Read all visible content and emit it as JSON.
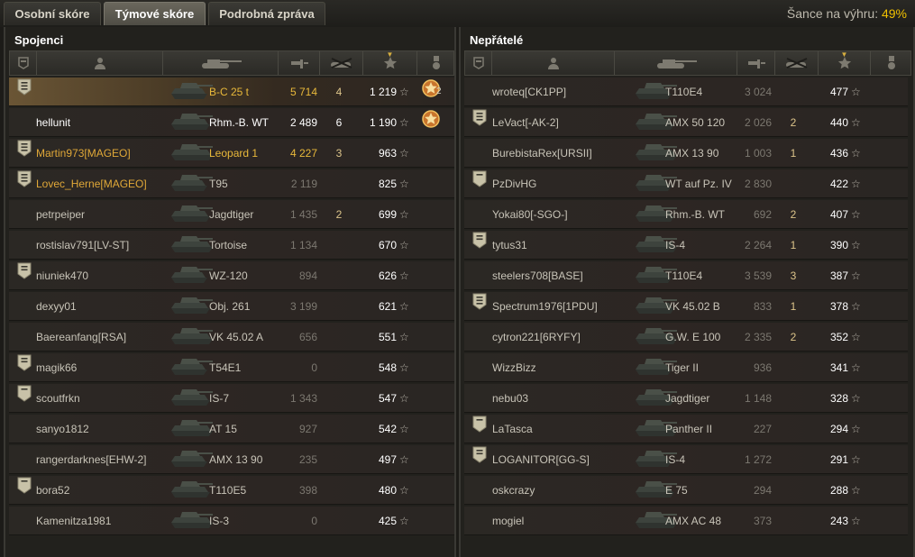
{
  "tabs": [
    {
      "label": "Osobní skóre",
      "active": false
    },
    {
      "label": "Týmové skóre",
      "active": true
    },
    {
      "label": "Podrobná zpráva",
      "active": false
    }
  ],
  "win_chance": {
    "label": "Šance na výhru:",
    "value": "49%"
  },
  "allies": {
    "title": "Spojenci",
    "rows": [
      {
        "badge": "3",
        "player": "",
        "vehicle": "B-C 25 t",
        "damage": "5 714",
        "kills": "4",
        "score": "1 219",
        "style": "gold",
        "highlight": true,
        "medal": true,
        "medal_count": "2"
      },
      {
        "badge": "",
        "player": "hellunit",
        "vehicle": "Rhm.-B. WT",
        "damage": "2 489",
        "kills": "6",
        "score": "1 190",
        "style": "white",
        "highlight": false,
        "medal": true,
        "medal_count": ""
      },
      {
        "badge": "3",
        "player": "Martin973[MAGEO]",
        "vehicle": "Leopard 1",
        "damage": "4 227",
        "kills": "3",
        "score": "963",
        "style": "gold",
        "highlight": false,
        "medal": false
      },
      {
        "badge": "3",
        "player": "Lovec_Herne[MAGEO]",
        "vehicle": "T95",
        "damage": "2 119",
        "kills": "",
        "score": "825",
        "style": "goldname",
        "highlight": false,
        "medal": false
      },
      {
        "badge": "",
        "player": "petrpeiper",
        "vehicle": "Jagdtiger",
        "damage": "1 435",
        "kills": "2",
        "score": "699",
        "style": "normal",
        "highlight": false,
        "medal": false
      },
      {
        "badge": "",
        "player": "rostislav791[LV-ST]",
        "vehicle": "Tortoise",
        "damage": "1 134",
        "kills": "",
        "score": "670",
        "style": "normal",
        "highlight": false,
        "medal": false
      },
      {
        "badge": "2",
        "player": "niuniek470",
        "vehicle": "WZ-120",
        "damage": "894",
        "kills": "",
        "score": "626",
        "style": "normal",
        "highlight": false,
        "medal": false
      },
      {
        "badge": "",
        "player": "dexyy01",
        "vehicle": "Obj. 261",
        "damage": "3 199",
        "kills": "",
        "score": "621",
        "style": "normal",
        "highlight": false,
        "medal": false
      },
      {
        "badge": "",
        "player": "Baereanfang[RSA]",
        "vehicle": "VK 45.02 A",
        "damage": "656",
        "kills": "",
        "score": "551",
        "style": "normal",
        "highlight": false,
        "medal": false
      },
      {
        "badge": "2",
        "player": "magik66",
        "vehicle": "T54E1",
        "damage": "0",
        "kills": "",
        "score": "548",
        "style": "normal",
        "highlight": false,
        "medal": false
      },
      {
        "badge": "1",
        "player": "scoutfrkn",
        "vehicle": "IS-7",
        "damage": "1 343",
        "kills": "",
        "score": "547",
        "style": "normal",
        "highlight": false,
        "medal": false
      },
      {
        "badge": "",
        "player": "sanyo1812",
        "vehicle": "AT 15",
        "damage": "927",
        "kills": "",
        "score": "542",
        "style": "normal",
        "highlight": false,
        "medal": false
      },
      {
        "badge": "",
        "player": "rangerdarknes[EHW-2]",
        "vehicle": "AMX 13 90",
        "damage": "235",
        "kills": "",
        "score": "497",
        "style": "normal",
        "highlight": false,
        "medal": false
      },
      {
        "badge": "1",
        "player": "bora52",
        "vehicle": "T110E5",
        "damage": "398",
        "kills": "",
        "score": "480",
        "style": "normal",
        "highlight": false,
        "medal": false
      },
      {
        "badge": "",
        "player": "Kamenitza1981",
        "vehicle": "IS-3",
        "damage": "0",
        "kills": "",
        "score": "425",
        "style": "normal",
        "highlight": false,
        "medal": false
      }
    ]
  },
  "enemies": {
    "title": "Nepřátelé",
    "rows": [
      {
        "badge": "",
        "player": "wroteq[CK1PP]",
        "vehicle": "T110E4",
        "damage": "3 024",
        "kills": "",
        "score": "477"
      },
      {
        "badge": "3",
        "player": "LeVact[-AK-2]",
        "vehicle": "AMX 50 120",
        "damage": "2 026",
        "kills": "2",
        "score": "440"
      },
      {
        "badge": "",
        "player": "BurebistaRex[URSII]",
        "vehicle": "AMX 13 90",
        "damage": "1 003",
        "kills": "1",
        "score": "436"
      },
      {
        "badge": "1",
        "player": "PzDivHG",
        "vehicle": "WT auf Pz. IV",
        "damage": "2 830",
        "kills": "",
        "score": "422"
      },
      {
        "badge": "",
        "player": "Yokai80[-SGO-]",
        "vehicle": "Rhm.-B. WT",
        "damage": "692",
        "kills": "2",
        "score": "407"
      },
      {
        "badge": "2",
        "player": "tytus31",
        "vehicle": "IS-4",
        "damage": "2 264",
        "kills": "1",
        "score": "390"
      },
      {
        "badge": "",
        "player": "steelers708[BASE]",
        "vehicle": "T110E4",
        "damage": "3 539",
        "kills": "3",
        "score": "387"
      },
      {
        "badge": "3",
        "player": "Spectrum1976[1PDU]",
        "vehicle": "VK 45.02 B",
        "damage": "833",
        "kills": "1",
        "score": "378"
      },
      {
        "badge": "",
        "player": "cytron221[6RYFY]",
        "vehicle": "G.W. E 100",
        "damage": "2 335",
        "kills": "2",
        "score": "352"
      },
      {
        "badge": "",
        "player": "WizzBizz",
        "vehicle": "Tiger II",
        "damage": "936",
        "kills": "",
        "score": "341"
      },
      {
        "badge": "",
        "player": "nebu03",
        "vehicle": "Jagdtiger",
        "damage": "1 148",
        "kills": "",
        "score": "328"
      },
      {
        "badge": "1",
        "player": "LaTasca",
        "vehicle": "Panther II",
        "damage": "227",
        "kills": "",
        "score": "294"
      },
      {
        "badge": "2",
        "player": "LOGANITOR[GG-S]",
        "vehicle": "IS-4",
        "damage": "1 272",
        "kills": "",
        "score": "291"
      },
      {
        "badge": "",
        "player": "oskcrazy",
        "vehicle": "E 75",
        "damage": "294",
        "kills": "",
        "score": "288"
      },
      {
        "badge": "",
        "player": "mogiel",
        "vehicle": "AMX AC 48",
        "damage": "373",
        "kills": "",
        "score": "243"
      }
    ]
  },
  "icons": {
    "col_badge": "badge-column-icon",
    "col_player": "player-column-icon",
    "col_vehicle": "tank-column-icon",
    "col_damage": "damage-column-icon",
    "col_kills": "kills-column-icon",
    "col_score": "star-column-icon",
    "col_medal": "medal-column-icon",
    "row_star": "star-icon"
  },
  "colors": {
    "gold": "#e8b83a",
    "win_chance": "#f0c000",
    "highlight_row": "#6a5535"
  }
}
